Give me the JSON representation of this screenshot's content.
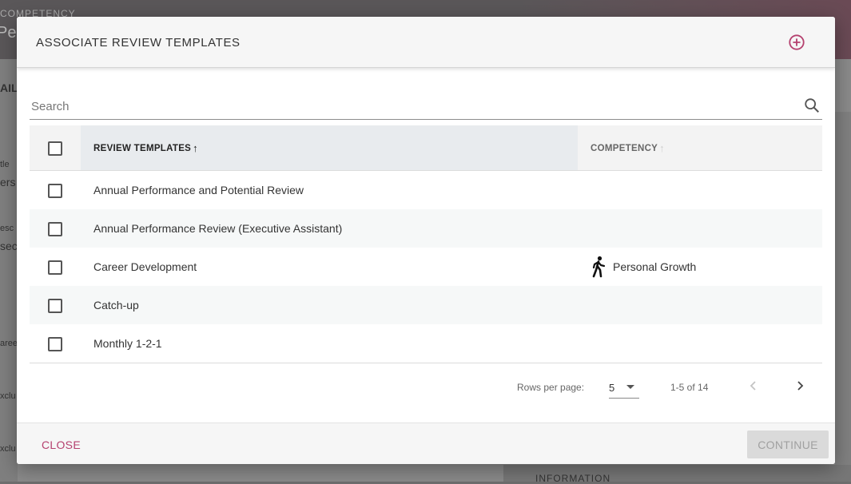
{
  "background": {
    "label": "COMPETENCY",
    "title": "Per",
    "side_texts": [
      "AIL",
      "tle",
      "ers",
      "esc",
      "sec",
      "aree",
      "xclu",
      "xclu"
    ],
    "bottom_text": "INFORMATION"
  },
  "modal": {
    "title": "ASSOCIATE REVIEW TEMPLATES",
    "add_icon": "add-circle-icon",
    "accent_color": "#b5416f"
  },
  "search": {
    "placeholder": "Search",
    "value": "",
    "icon": "search-icon"
  },
  "table": {
    "columns": [
      {
        "label": "REVIEW TEMPLATES",
        "sort": "asc"
      },
      {
        "label": "COMPETENCY",
        "sort": "none"
      }
    ],
    "rows": [
      {
        "name": "Annual Performance and Potential Review",
        "competency": "",
        "competency_icon": ""
      },
      {
        "name": "Annual Performance Review (Executive Assistant)",
        "competency": "",
        "competency_icon": ""
      },
      {
        "name": "Career Development",
        "competency": "Personal Growth",
        "competency_icon": "walking-person-icon"
      },
      {
        "name": "Catch-up",
        "competency": "",
        "competency_icon": ""
      },
      {
        "name": "Monthly 1-2-1",
        "competency": "",
        "competency_icon": ""
      }
    ]
  },
  "pagination": {
    "rows_per_page_label": "Rows per page:",
    "rows_per_page_value": "5",
    "range_text": "1-5 of 14"
  },
  "footer": {
    "close_label": "CLOSE",
    "continue_label": "CONTINUE"
  }
}
